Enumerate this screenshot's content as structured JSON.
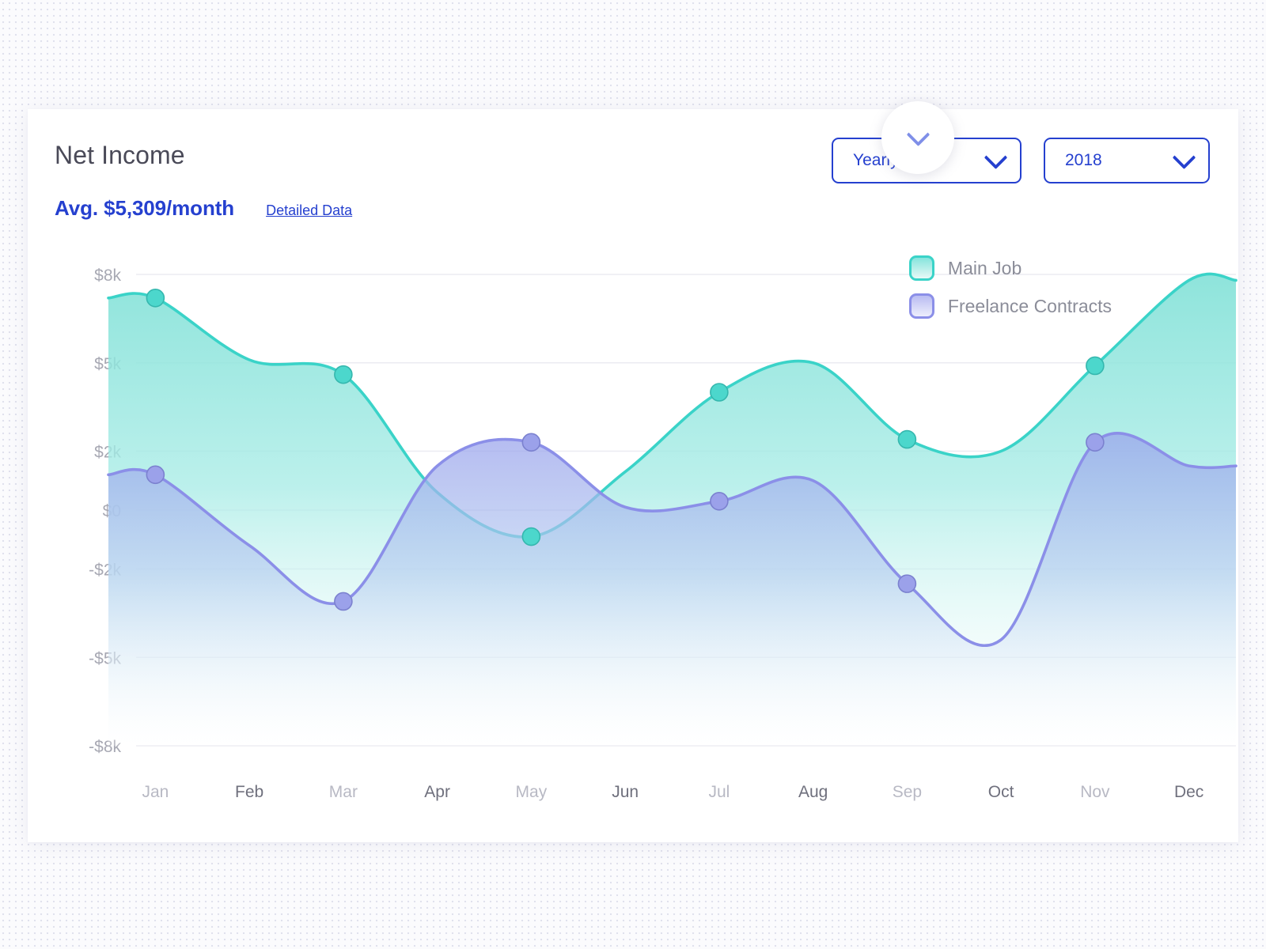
{
  "header": {
    "title": "Net Income",
    "avg_value": "Avg. $5,309/month",
    "detail_link": "Detailed Data"
  },
  "controls": {
    "period": {
      "value": "Yearly",
      "chevron_icon": "chevron-down-icon"
    },
    "year": {
      "value": "2018",
      "chevron_icon": "chevron-down-icon"
    }
  },
  "legend": [
    {
      "label": "Main Job",
      "color": "#3ad3c8"
    },
    {
      "label": "Freelance Contracts",
      "color": "#8b8fe8"
    }
  ],
  "colors": {
    "accent_blue": "#2540cf",
    "main_job": "#3ad3c8",
    "freelance": "#8b8fe8",
    "title_gray": "#4a4a58",
    "tick_gray": "#a7a8b3",
    "card_bg": "#ffffff",
    "page_bg": "#fbfbfd"
  },
  "chart_data": {
    "type": "area",
    "title": "Net Income",
    "xlabel": "",
    "ylabel": "",
    "grid": true,
    "legend_position": "top-right",
    "categories": [
      "Jan",
      "Feb",
      "Mar",
      "Apr",
      "May",
      "Jun",
      "Jul",
      "Aug",
      "Sep",
      "Oct",
      "Nov",
      "Dec"
    ],
    "ytick_labels": [
      "$8k",
      "$5k",
      "$2k",
      "$0",
      "-$2k",
      "-$5k",
      "-$8k"
    ],
    "ytick_values": [
      8000,
      5000,
      2000,
      0,
      -2000,
      -5000,
      -8000
    ],
    "ylim": [
      -8000,
      8000
    ],
    "series": [
      {
        "name": "Main Job",
        "color": "#3ad3c8",
        "values": [
          7200,
          5100,
          4600,
          600,
          -900,
          1300,
          4000,
          5000,
          2400,
          2000,
          4900,
          7800
        ]
      },
      {
        "name": "Freelance Contracts",
        "color": "#8b8fe8",
        "values": [
          1200,
          -1200,
          -3100,
          1500,
          2300,
          100,
          300,
          1000,
          -2500,
          -4400,
          2300,
          1500
        ]
      }
    ]
  }
}
